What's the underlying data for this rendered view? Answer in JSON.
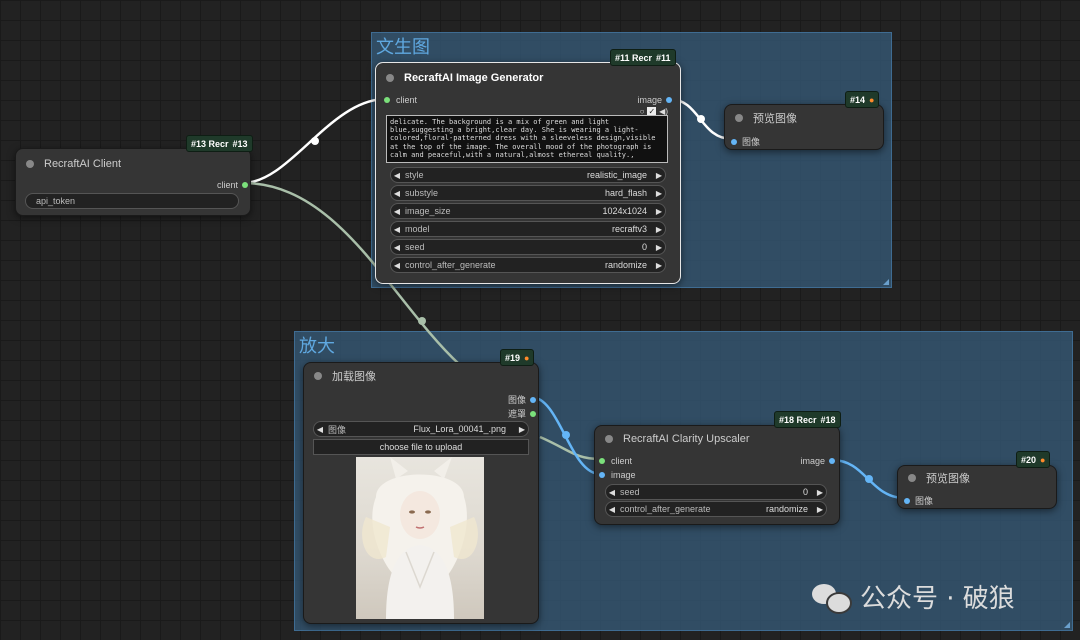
{
  "groups": {
    "text_to_image": {
      "title": "文生图"
    },
    "upscale": {
      "title": "放大"
    }
  },
  "nodes": {
    "client": {
      "title": "RecraftAI Client",
      "badge": "#13 Recr",
      "badge_id": "#13",
      "output": "client",
      "api_token": "api_token"
    },
    "generator": {
      "title": "RecraftAI Image Generator",
      "badge": "#11 Recr",
      "badge_id": "#11",
      "input": "client",
      "output": "image",
      "prompt": "delicate. The background is a mix of green and light blue,suggesting a bright,clear day. She is wearing a light-colored,floral-patterned dress with a sleeveless design,visible at the top of the image. The overall mood of the photograph is calm and peaceful,with a natural,almost ethereal quality.,",
      "widgets": [
        {
          "label": "style",
          "value": "realistic_image"
        },
        {
          "label": "substyle",
          "value": "hard_flash"
        },
        {
          "label": "image_size",
          "value": "1024x1024"
        },
        {
          "label": "model",
          "value": "recraftv3"
        },
        {
          "label": "seed",
          "value": "0"
        },
        {
          "label": "control_after_generate",
          "value": "randomize"
        }
      ]
    },
    "preview14": {
      "title": "预览图像",
      "badge_id": "#14",
      "input": "图像"
    },
    "load_image": {
      "title": "加载图像",
      "badge_id": "#19",
      "output_image": "图像",
      "output_mask": "遮罩",
      "widget_label": "图像",
      "widget_value": "Flux_Lora_00041_.png",
      "upload_label": "choose file to upload"
    },
    "upscaler": {
      "title": "RecraftAI Clarity Upscaler",
      "badge": "#18 Recr",
      "badge_id": "#18",
      "input_client": "client",
      "input_image": "image",
      "output": "image",
      "widgets": [
        {
          "label": "seed",
          "value": "0"
        },
        {
          "label": "control_after_generate",
          "value": "randomize"
        }
      ]
    },
    "preview20": {
      "title": "预览图像",
      "badge_id": "#20",
      "input": "图像"
    }
  },
  "watermark": {
    "text": "公众号 · 破狼"
  },
  "colors": {
    "group_fill": "#345570",
    "node_bg": "#353535",
    "socket_green": "#7be07b",
    "socket_blue": "#64b5f6",
    "link_white": "#ffffff",
    "link_client": "#a9bfa9",
    "link_image": "#64b5f6",
    "badge_fox": "#ff8a2a"
  }
}
